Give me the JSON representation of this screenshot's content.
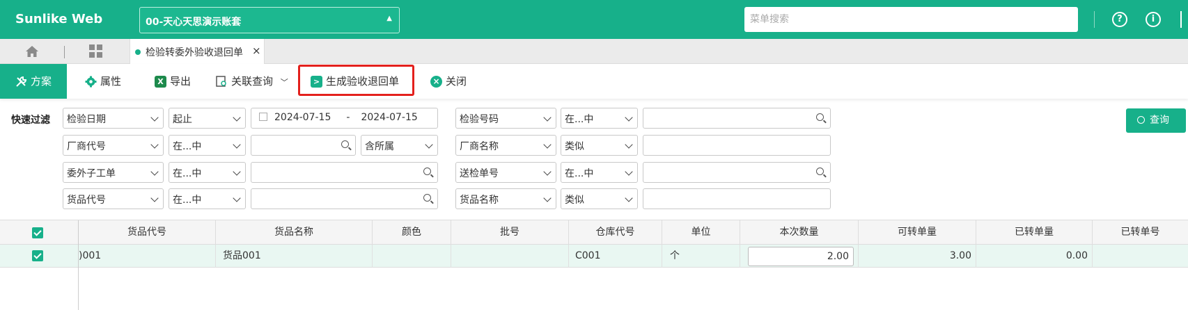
{
  "app": {
    "title": "Sunlike Web",
    "account": "00-天心天思演示账套"
  },
  "header": {
    "menu_search_placeholder": "菜单搜索",
    "help_icon": "?",
    "info_icon": "i"
  },
  "tabs": {
    "active_label": "检验转委外验收退回单",
    "close": "×"
  },
  "toolbar": {
    "scheme": "方案",
    "attributes": "属性",
    "export": "导出",
    "related_query": "关联查询",
    "generate": "生成验收退回单",
    "close": "关闭"
  },
  "filter": {
    "label": "快速过滤",
    "rows": [
      {
        "field1": "检验日期",
        "op1": "起止",
        "date_from": "2024-07-15",
        "date_sep": "-",
        "date_to": "2024-07-15",
        "field2": "检验号码",
        "op2": "在...中",
        "value2": ""
      },
      {
        "field1": "厂商代号",
        "op1": "在...中",
        "value1": "",
        "extra": "含所属",
        "field2": "厂商名称",
        "op2": "类似",
        "value2": ""
      },
      {
        "field1": "委外子工单",
        "op1": "在...中",
        "value1": "",
        "field2": "送检单号",
        "op2": "在...中",
        "value2": ""
      },
      {
        "field1": "货品代号",
        "op1": "在...中",
        "value1": "",
        "field2": "货品名称",
        "op2": "类似",
        "value2": ""
      }
    ],
    "query_button": "查询"
  },
  "grid": {
    "columns": [
      "货品代号",
      "货品名称",
      "颜色",
      "批号",
      "仓库代号",
      "单位",
      "本次数量",
      "可转单量",
      "已转单量",
      "已转单号"
    ],
    "rows": [
      {
        "item_code": ")001",
        "item_name": "货品001",
        "color": "",
        "batch": "",
        "warehouse": "C001",
        "unit": "个",
        "qty": "2.00",
        "convertible": "3.00",
        "converted": "0.00",
        "converted_no": ""
      }
    ]
  },
  "colors": {
    "brand": "#17b08a",
    "highlight": "#e3201c"
  }
}
